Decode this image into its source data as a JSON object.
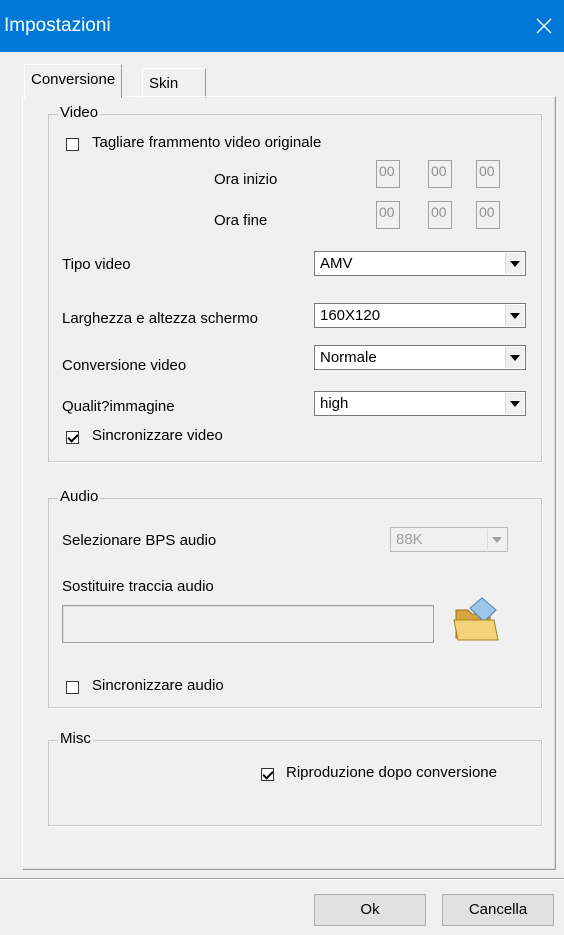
{
  "window": {
    "title": "Impostazioni"
  },
  "tabs": [
    {
      "label": "Conversione"
    },
    {
      "label": "Skin"
    }
  ],
  "video": {
    "legend": "Video",
    "cut_label": "Tagliare frammento video originale",
    "start_label": "Ora inizio",
    "end_label": "Ora fine",
    "start_values": [
      "00",
      "00",
      "00"
    ],
    "end_values": [
      "00",
      "00",
      "00"
    ],
    "type_label": "Tipo video",
    "type_value": "AMV",
    "size_label": "Larghezza e altezza schermo",
    "size_value": "160X120",
    "conversion_label": "Conversione video",
    "conversion_value": "Normale",
    "quality_label": "Qualit?immagine",
    "quality_value": "high",
    "sync_label": "Sincronizzare video",
    "sync_checked": true,
    "cut_checked": false
  },
  "audio": {
    "legend": "Audio",
    "bps_label": "Selezionare BPS audio",
    "bps_value": "88K",
    "replace_label": "Sostituire traccia audio",
    "replace_value": "",
    "sync_label": "Sincronizzare audio",
    "sync_checked": false
  },
  "misc": {
    "legend": "Misc",
    "play_label": "Riproduzione dopo conversione",
    "play_checked": true
  },
  "buttons": {
    "ok": "Ok",
    "cancel": "Cancella"
  },
  "icons": {
    "close": "close-icon",
    "folder": "open-folder-icon"
  }
}
